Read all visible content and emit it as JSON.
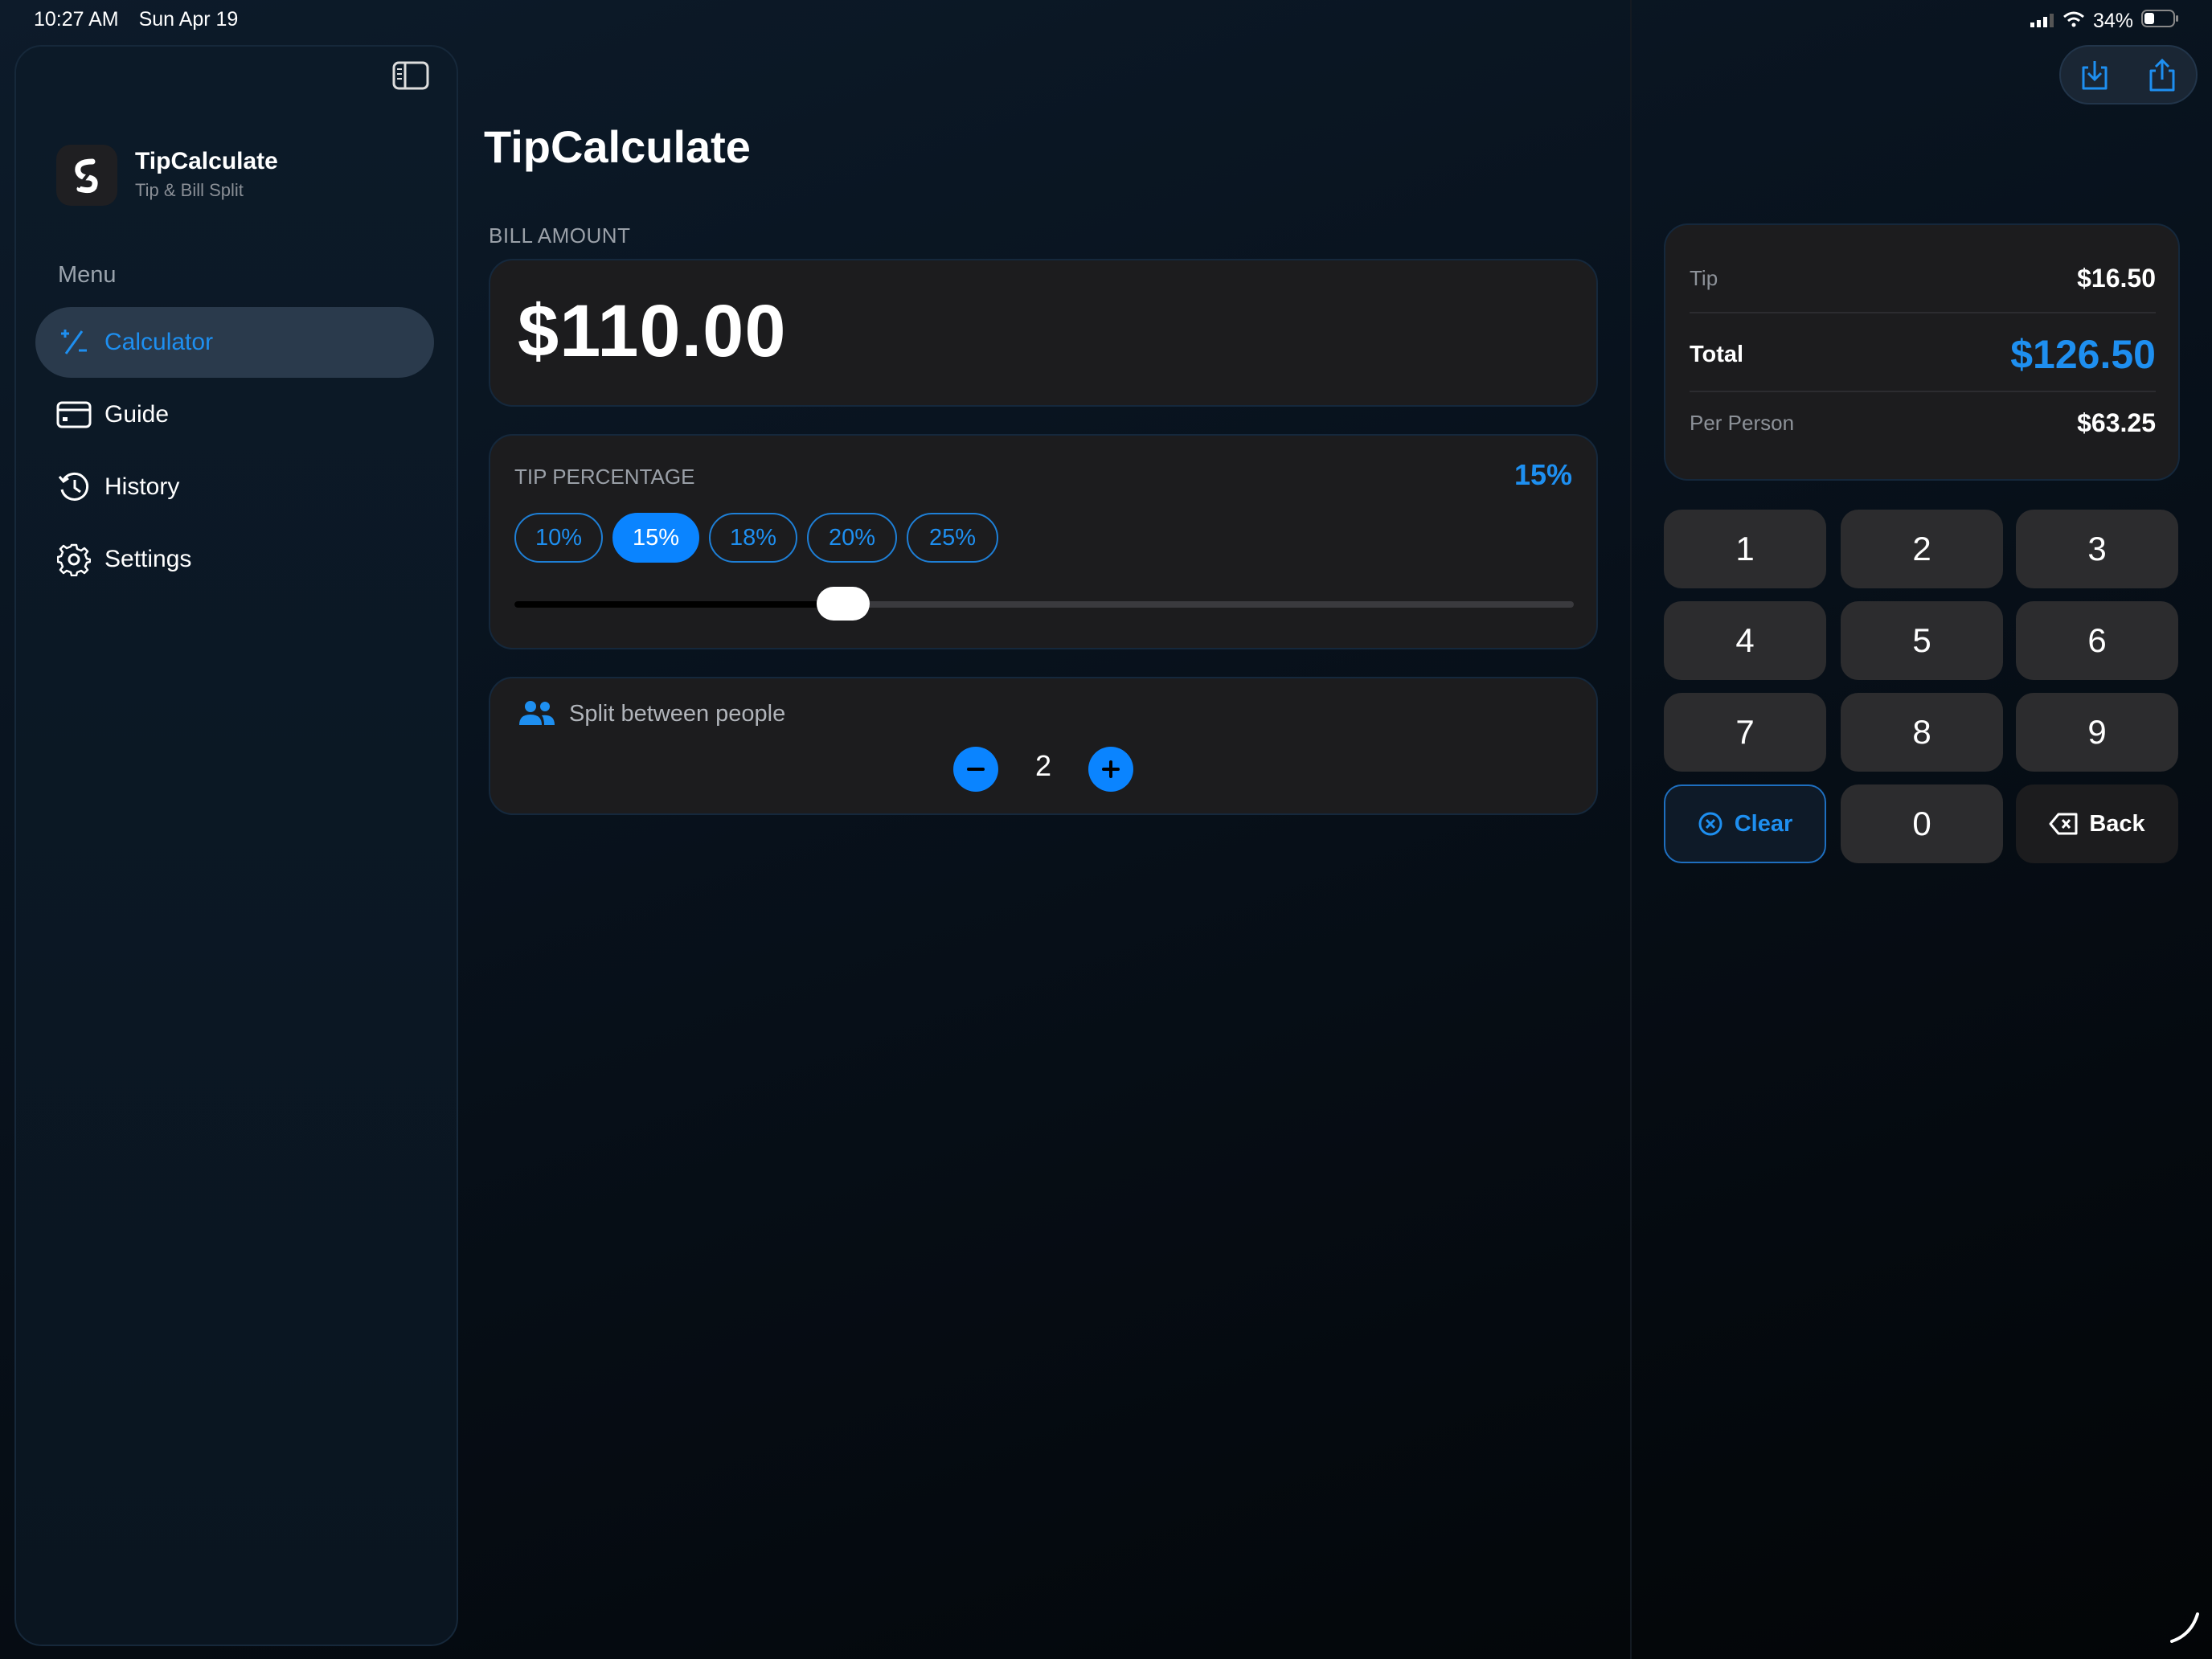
{
  "status": {
    "time": "10:27 AM",
    "date": "Sun Apr 19",
    "battery": "34%"
  },
  "sidebar": {
    "app_name": "TipCalculate",
    "app_subtitle": "Tip & Bill Split",
    "menu_header": "Menu",
    "items": [
      {
        "label": "Calculator",
        "icon": "plus-minus-icon",
        "active": true
      },
      {
        "label": "Guide",
        "icon": "card-icon",
        "active": false
      },
      {
        "label": "History",
        "icon": "clock-history-icon",
        "active": false
      },
      {
        "label": "Settings",
        "icon": "gear-icon",
        "active": false
      }
    ]
  },
  "main": {
    "title": "TipCalculate",
    "bill_label": "BILL AMOUNT",
    "bill_value": "$110.00",
    "tip_label": "TIP PERCENTAGE",
    "tip_current": "15%",
    "tip_options": [
      "10%",
      "15%",
      "18%",
      "20%",
      "25%"
    ],
    "tip_selected_index": 1,
    "slider_fraction": 0.31,
    "split_label": "Split between people",
    "split_count": "2"
  },
  "summary": {
    "tip_label": "Tip",
    "tip_value": "$16.50",
    "total_label": "Total",
    "total_value": "$126.50",
    "per_person_label": "Per Person",
    "per_person_value": "$63.25"
  },
  "keypad": {
    "keys": [
      "1",
      "2",
      "3",
      "4",
      "5",
      "6",
      "7",
      "8",
      "9"
    ],
    "zero": "0",
    "clear": "Clear",
    "back": "Back"
  },
  "colors": {
    "accent": "#0a84ff",
    "card": "#1c1c1e",
    "key": "#2c2c2e"
  }
}
